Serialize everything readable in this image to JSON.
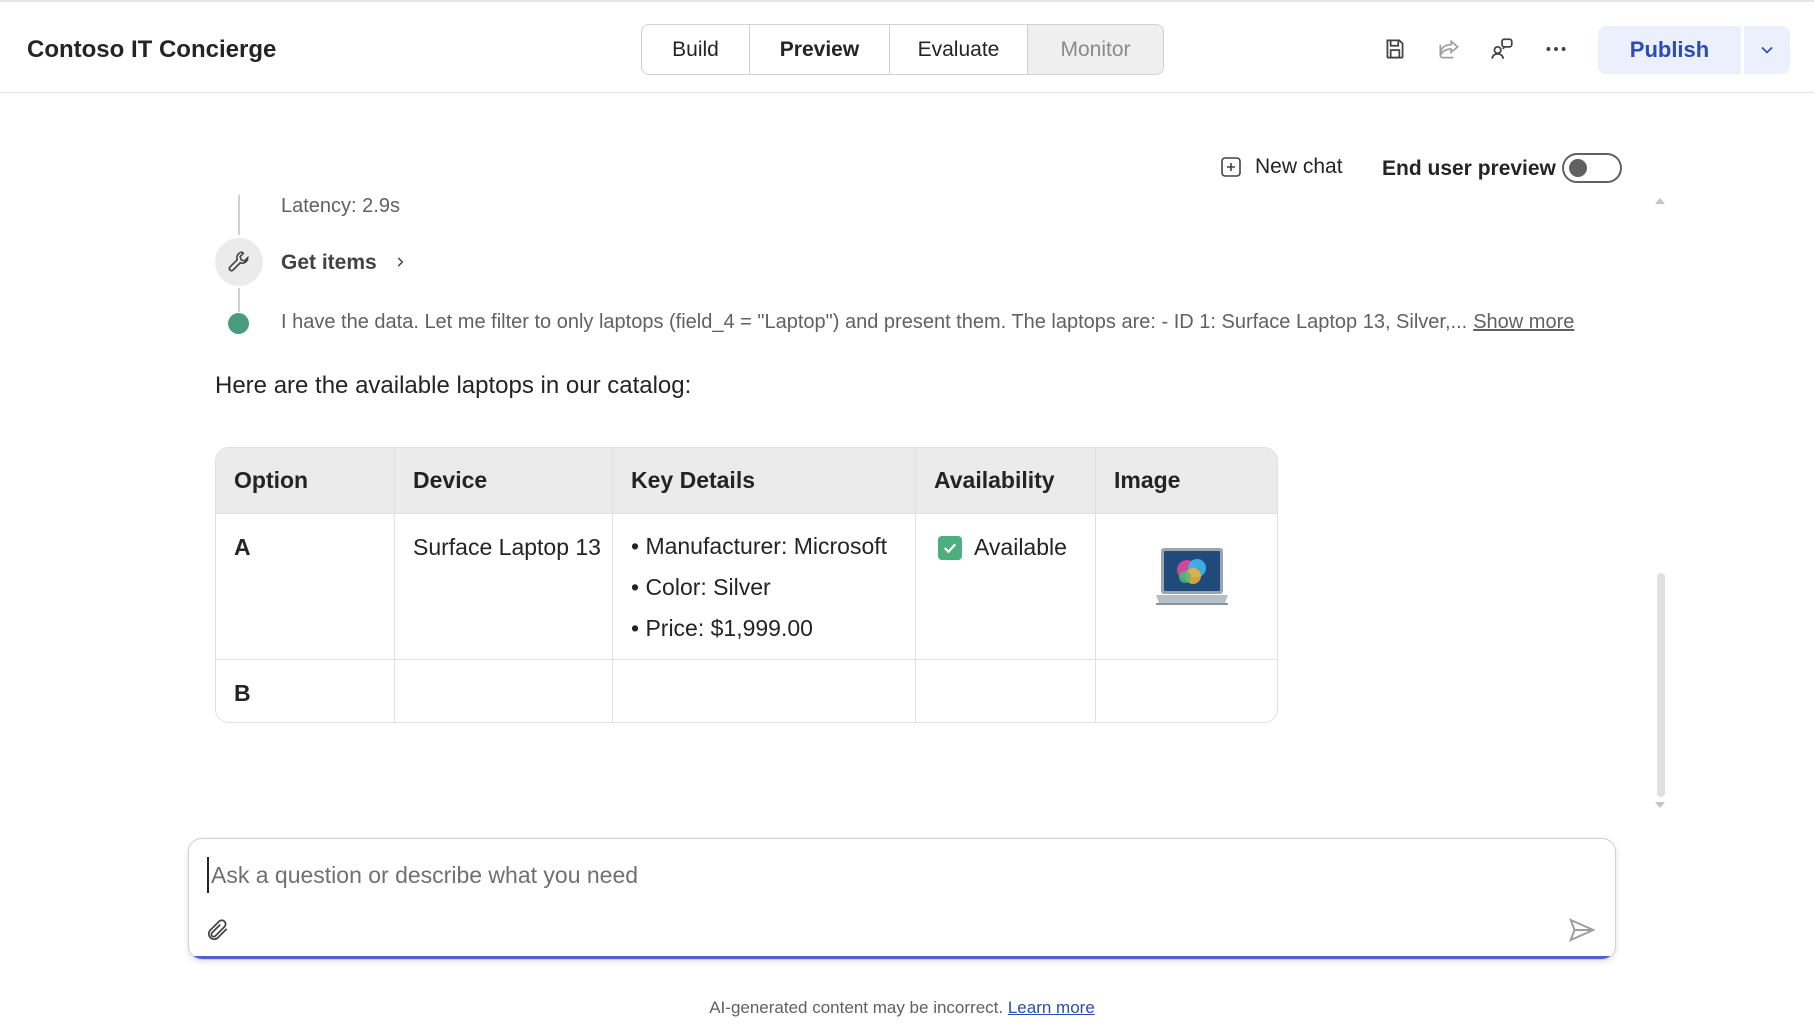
{
  "app": {
    "title": "Contoso IT Concierge"
  },
  "tabs": [
    {
      "label": "Build",
      "state": "normal"
    },
    {
      "label": "Preview",
      "state": "selected"
    },
    {
      "label": "Evaluate",
      "state": "normal"
    },
    {
      "label": "Monitor",
      "state": "disabled"
    }
  ],
  "header_actions": {
    "icons": [
      "save-icon",
      "share-icon",
      "collaborators-icon",
      "more-options-icon"
    ],
    "publish_label": "Publish",
    "accent_color": "#2d4bb5"
  },
  "preview_toolbar": {
    "new_chat_label": "New chat",
    "end_user_preview_label": "End user preview",
    "end_user_preview_on": false
  },
  "activity": {
    "latency": "Latency: 2.9s",
    "tool_name": "Get items",
    "thought": "I have the data. Let me filter to only laptops (field_4 = \"Laptop\") and present them. The laptops are: - ID 1: Surface Laptop 13, Silver,...",
    "show_more_label": "Show more"
  },
  "response": {
    "intro": "Here are the available laptops in our catalog:",
    "table": {
      "headers": [
        "Option",
        "Device",
        "Key Details",
        "Availability",
        "Image"
      ],
      "rows": [
        {
          "option": "A",
          "device": "Surface Laptop 13",
          "details": [
            "• Manufacturer: Microsoft",
            "• Color: Silver",
            "• Price: $1,999.00"
          ],
          "availability": "Available",
          "image": "laptop-image"
        },
        {
          "option": "B",
          "device": "",
          "details": [],
          "availability": "",
          "image": ""
        }
      ]
    }
  },
  "composer": {
    "placeholder": "Ask a question or describe what you need",
    "value": ""
  },
  "footer": {
    "disclaimer": "AI-generated content may be incorrect.",
    "learn_more_label": "Learn more"
  }
}
